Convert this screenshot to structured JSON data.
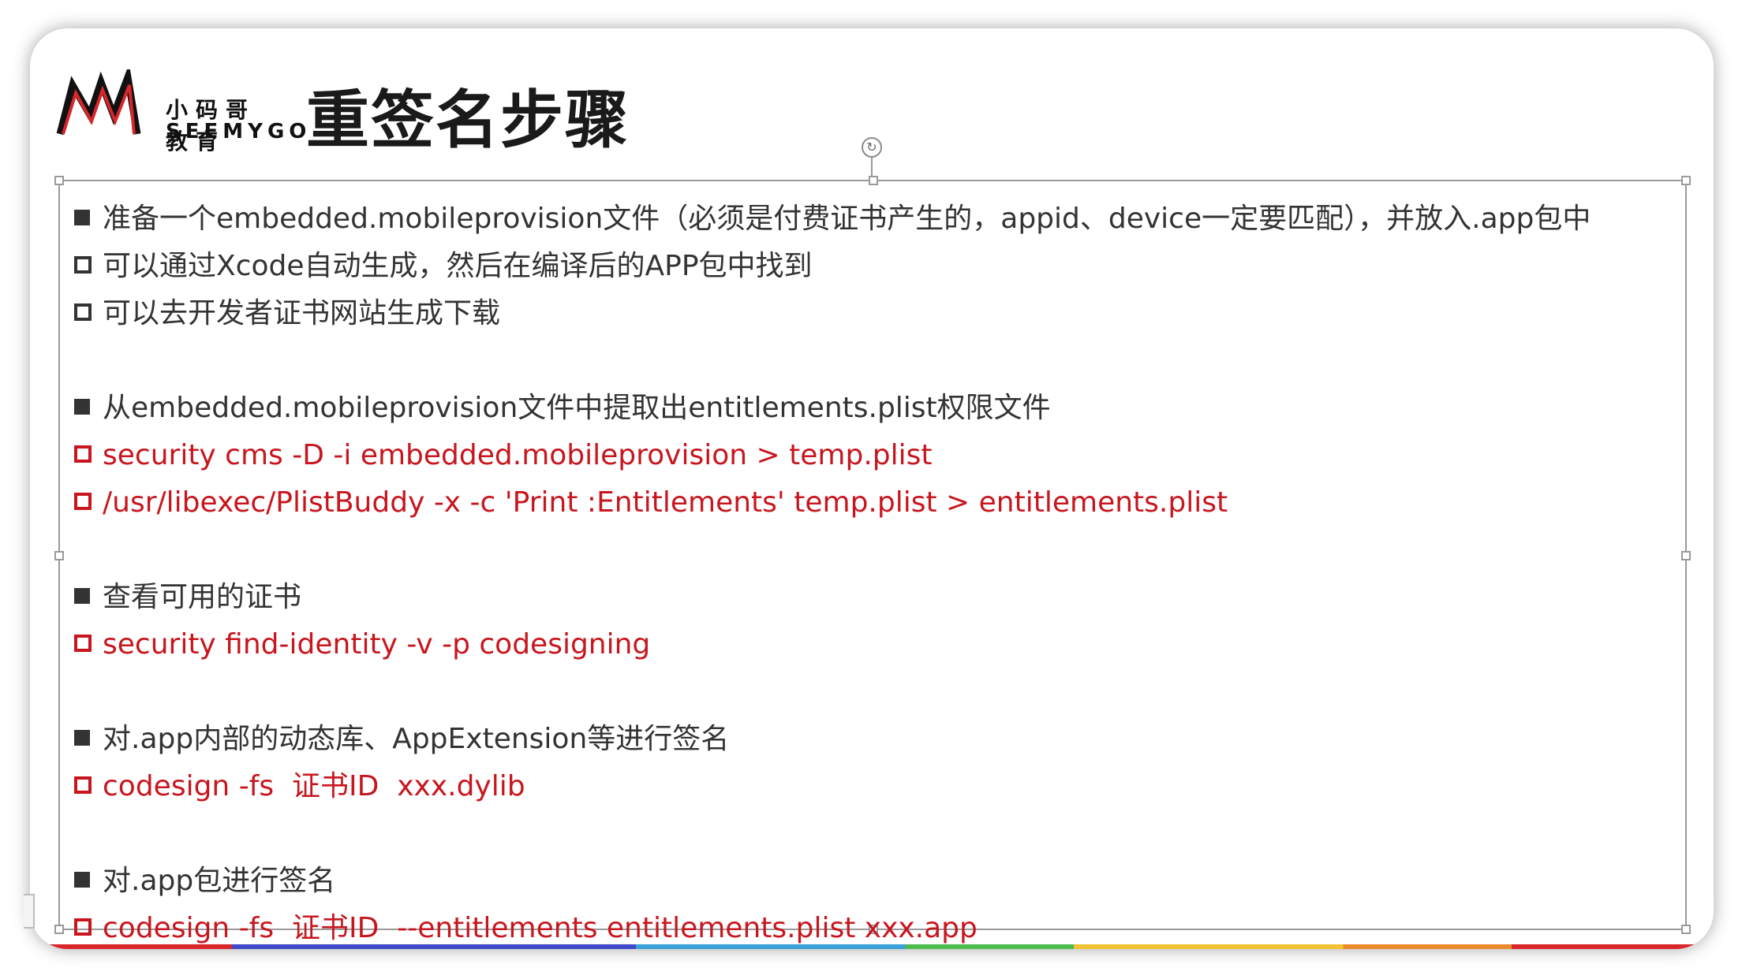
{
  "slide": {
    "title": "重签名步骤",
    "logo": {
      "cn": "小码哥教育",
      "en": "SEEMYGO"
    },
    "rotate_symbol": "↻",
    "colors": {
      "text": "#333333",
      "command": "#c8161e"
    },
    "lines": [
      {
        "style": "black",
        "bullet": "filled",
        "text": "准备一个embedded.mobileprovision文件（必须是付费证书产生的，appid、device一定要匹配），并放入.app包中"
      },
      {
        "style": "black",
        "bullet": "hollow",
        "text": "可以通过Xcode自动生成，然后在编译后的APP包中找到"
      },
      {
        "style": "black",
        "bullet": "hollow",
        "text": "可以去开发者证书网站生成下载"
      },
      {
        "style": "black",
        "bullet": "filled",
        "text": "从embedded.mobileprovision文件中提取出entitlements.plist权限文件"
      },
      {
        "style": "red",
        "bullet": "hollow",
        "text": "security cms -D -i embedded.mobileprovision > temp.plist"
      },
      {
        "style": "red",
        "bullet": "hollow",
        "text": "/usr/libexec/PlistBuddy -x -c 'Print :Entitlements' temp.plist > entitlements.plist"
      },
      {
        "style": "black",
        "bullet": "filled",
        "text": "查看可用的证书"
      },
      {
        "style": "red",
        "bullet": "hollow",
        "text": "security find-identity -v -p codesigning"
      },
      {
        "style": "black",
        "bullet": "filled",
        "text": "对.app内部的动态库、AppExtension等进行签名"
      },
      {
        "style": "red",
        "bullet": "hollow",
        "text": "codesign -fs  证书ID  xxx.dylib"
      },
      {
        "style": "black",
        "bullet": "filled",
        "text": "对.app包进行签名"
      },
      {
        "style": "red",
        "bullet": "hollow",
        "text": "codesign -fs  证书ID  --entitlements entitlements.plist xxx.app"
      }
    ]
  }
}
